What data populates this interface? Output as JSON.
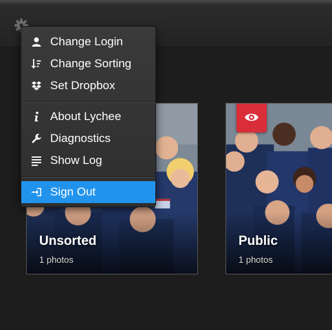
{
  "menu": {
    "items": [
      {
        "label": "Change Login",
        "icon": "user-icon"
      },
      {
        "label": "Change Sorting",
        "icon": "sort-icon"
      },
      {
        "label": "Set Dropbox",
        "icon": "dropbox-icon"
      },
      {
        "label": "About Lychee",
        "icon": "info-icon"
      },
      {
        "label": "Diagnostics",
        "icon": "wrench-icon"
      },
      {
        "label": "Show Log",
        "icon": "log-icon"
      },
      {
        "label": "Sign Out",
        "icon": "sign-out-icon",
        "active": true
      }
    ]
  },
  "albums": [
    {
      "title": "Unsorted",
      "count": "1 photos"
    },
    {
      "title": "Public",
      "count": "1 photos",
      "badge": "eye-icon"
    }
  ],
  "colors": {
    "accent": "#2293ec",
    "badge": "#d92d3a",
    "background": "#1d1d1d"
  }
}
